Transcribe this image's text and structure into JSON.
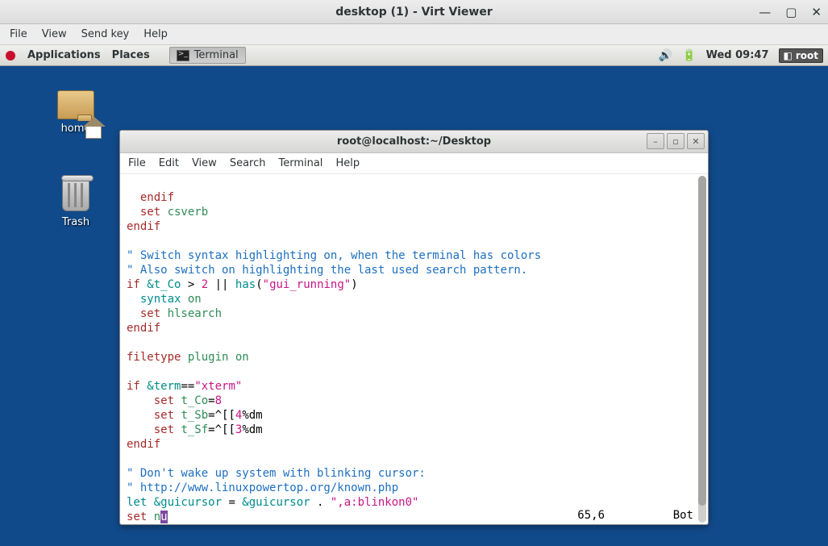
{
  "outer": {
    "title": "desktop (1) - Virt Viewer",
    "menu": [
      "File",
      "View",
      "Send key",
      "Help"
    ]
  },
  "guest_panel": {
    "applications": "Applications",
    "places": "Places",
    "task_terminal": "Terminal",
    "clock": "Wed 09:47",
    "user": "root"
  },
  "desktop": {
    "home": "home",
    "trash": "Trash"
  },
  "terminal": {
    "title": "root@localhost:~/Desktop",
    "menu": [
      "File",
      "Edit",
      "View",
      "Search",
      "Terminal",
      "Help"
    ],
    "status_pos": "65,6",
    "status_pct": "Bot",
    "code": {
      "l1": {
        "a": "  endif"
      },
      "l2": {
        "a": "  set ",
        "b": "csverb"
      },
      "l3": {
        "a": "endif"
      },
      "l4": "",
      "l5": {
        "a": "\" Switch syntax highlighting on, when the terminal has colors"
      },
      "l6": {
        "a": "\" Also switch on highlighting the last used search pattern."
      },
      "l7": {
        "a": "if ",
        "b": "&t_Co",
        "c": " > ",
        "d": "2",
        "e": " || ",
        "f": "has",
        "g": "(",
        "h": "\"gui_running\"",
        "i": ")"
      },
      "l8": {
        "a": "  syntax ",
        "b": "on"
      },
      "l9": {
        "a": "  set ",
        "b": "hlsearch"
      },
      "l10": {
        "a": "endif"
      },
      "l11": "",
      "l12": {
        "a": "filetype ",
        "b": "plugin ",
        "c": "on"
      },
      "l13": "",
      "l14": {
        "a": "if ",
        "b": "&term",
        "c": "==",
        "d": "\"xterm\""
      },
      "l15": {
        "a": "    set ",
        "b": "t_Co",
        "c": "=",
        "d": "8"
      },
      "l16": {
        "a": "    set ",
        "b": "t_Sb",
        "c": "=^[[",
        "d": "4",
        "e": "%dm"
      },
      "l17": {
        "a": "    set ",
        "b": "t_Sf",
        "c": "=^[[",
        "d": "3",
        "e": "%dm"
      },
      "l18": {
        "a": "endif"
      },
      "l19": "",
      "l20": {
        "a": "\" Don't wake up system with blinking cursor:"
      },
      "l21": {
        "a": "\" http://www.linuxpowertop.org/known.php"
      },
      "l22": {
        "a": "let ",
        "b": "&guicursor ",
        "c": "= ",
        "d": "&guicursor ",
        "e": ". ",
        "f": "\",a:blinkon0\""
      },
      "l23": {
        "a": "set ",
        "b": "n",
        "c": "u"
      }
    }
  }
}
